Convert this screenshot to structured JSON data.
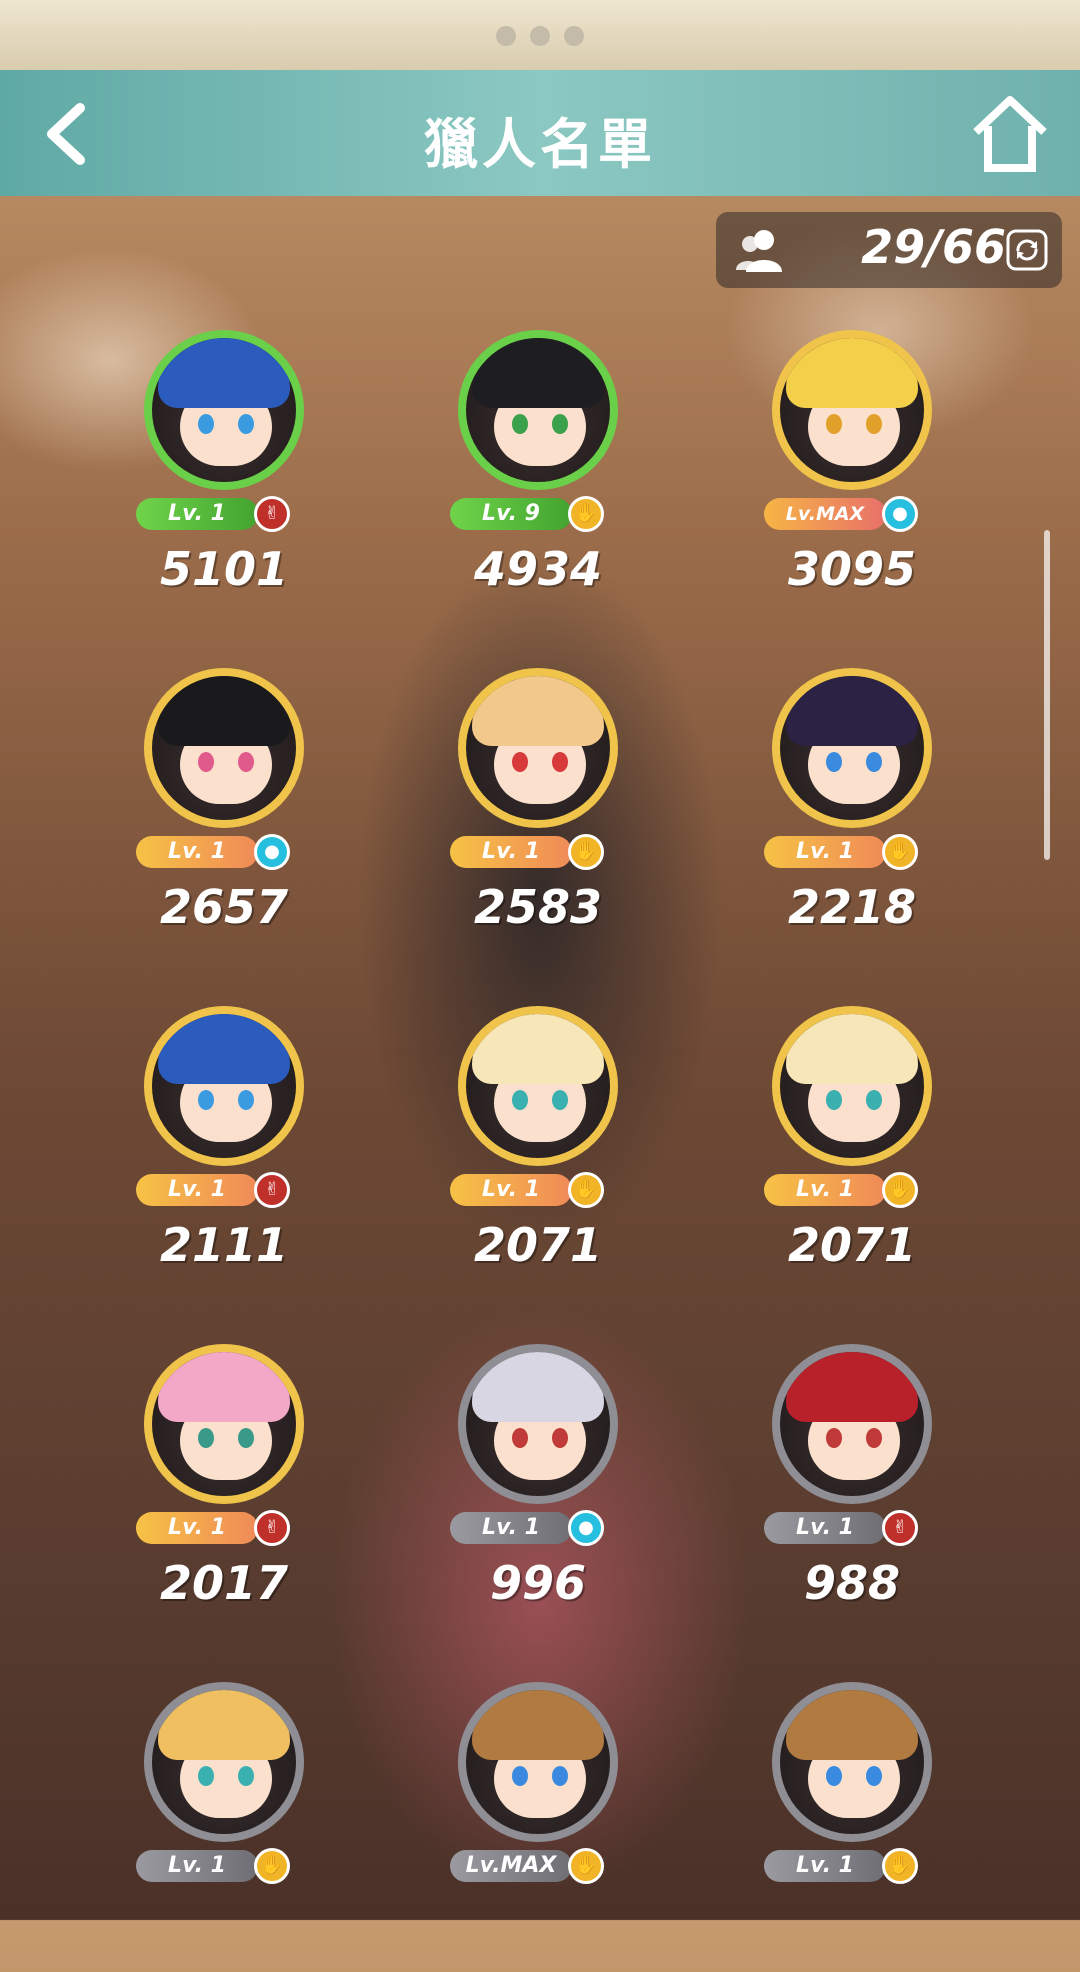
{
  "header": {
    "title": "獵人名單"
  },
  "counter": {
    "value": "29/66"
  },
  "hunters": [
    {
      "level": "Lv. 1",
      "power": "5101",
      "type": "scissors",
      "frame": "green",
      "hair": "#2a5bbd",
      "eyes": "#3a9be0"
    },
    {
      "level": "Lv. 9",
      "power": "4934",
      "type": "paper",
      "frame": "green",
      "hair": "#1e1e22",
      "eyes": "#3aa04a"
    },
    {
      "level": "Lv.MAX",
      "power": "3095",
      "type": "rock",
      "frame": "gold",
      "hair": "#f3cf4a",
      "eyes": "#e0a02a"
    },
    {
      "level": "Lv. 1",
      "power": "2657",
      "type": "rock",
      "frame": "gold",
      "hair": "#1a1a1c",
      "eyes": "#e05a8a"
    },
    {
      "level": "Lv. 1",
      "power": "2583",
      "type": "paper",
      "frame": "gold",
      "hair": "#f2c98a",
      "eyes": "#d63a3a"
    },
    {
      "level": "Lv. 1",
      "power": "2218",
      "type": "paper",
      "frame": "gold",
      "hair": "#2c2244",
      "eyes": "#3a8ae0"
    },
    {
      "level": "Lv. 1",
      "power": "2111",
      "type": "scissors",
      "frame": "gold",
      "hair": "#2a5bbd",
      "eyes": "#3a9be0"
    },
    {
      "level": "Lv. 1",
      "power": "2071",
      "type": "paper",
      "frame": "gold",
      "hair": "#f6e6b8",
      "eyes": "#3ab0b0"
    },
    {
      "level": "Lv. 1",
      "power": "2071",
      "type": "paper",
      "frame": "gold",
      "hair": "#f6e6b8",
      "eyes": "#3ab0b0"
    },
    {
      "level": "Lv. 1",
      "power": "2017",
      "type": "scissors",
      "frame": "gold",
      "hair": "#f4a8c8",
      "eyes": "#3a9a8a"
    },
    {
      "level": "Lv. 1",
      "power": "996",
      "type": "rock",
      "frame": "gray",
      "hair": "#d8d6e2",
      "eyes": "#c03a3a"
    },
    {
      "level": "Lv. 1",
      "power": "988",
      "type": "scissors",
      "frame": "gray",
      "hair": "#b8202a",
      "eyes": "#c03a3a"
    },
    {
      "level": "Lv. 1",
      "power": "",
      "type": "paper",
      "frame": "gray",
      "hair": "#f0c060",
      "eyes": "#3ab0b0"
    },
    {
      "level": "Lv.MAX",
      "power": "",
      "type": "paper",
      "frame": "gray",
      "hair": "#b07a40",
      "eyes": "#3a8ae0"
    },
    {
      "level": "Lv. 1",
      "power": "",
      "type": "paper",
      "frame": "gray",
      "hair": "#b07a40",
      "eyes": "#3a8ae0"
    }
  ]
}
